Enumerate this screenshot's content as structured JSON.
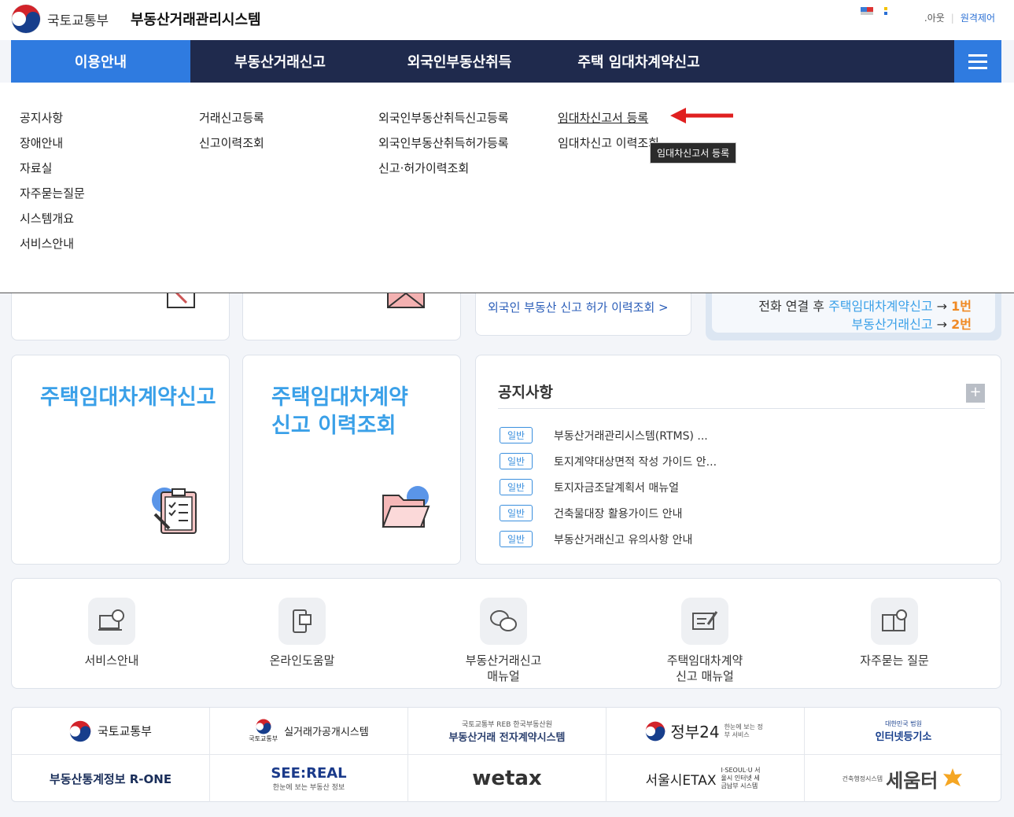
{
  "header": {
    "ministry": "국토교통부",
    "system": "부동산거래관리시스템",
    "links": {
      "about": ".아웃",
      "remote": "원격제어"
    }
  },
  "nav": {
    "items": [
      "이용안내",
      "부동산거래신고",
      "외국인부동산취득",
      "주택 임대차계약신고"
    ]
  },
  "mega_menu": {
    "col1": [
      "공지사항",
      "장애안내",
      "자료실",
      "자주묻는질문",
      "시스템개요",
      "서비스안내"
    ],
    "col2": [
      "거래신고등록",
      "신고이력조회"
    ],
    "col3": [
      "외국인부동산취득신고등록",
      "외국인부동산취득허가등록",
      "신고·허가이력조회"
    ],
    "col4": [
      "임대차신고서 등록",
      "임대차신고 이력조회"
    ],
    "tooltip": "임대차신고서 등록"
  },
  "partial": {
    "foreign_link": "외국인 부동산 신고 허가 이력조회 >",
    "phone_line1_prefix": "전화 연결 후 ",
    "phone_line1_blue": "주택임대차계약신고",
    "phone_line1_arrow": " → ",
    "phone_line1_num": "1번",
    "phone_line2_blue": "부동산거래신고",
    "phone_line2_arrow": " → ",
    "phone_line2_num": "2번"
  },
  "cards": {
    "card1": "주택임대차계약신고",
    "card2_line1": "주택임대차계약",
    "card2_line2": "신고 이력조회"
  },
  "notices": {
    "title": "공지사항",
    "more": "+",
    "items": [
      {
        "badge": "일반",
        "text": "부동산거래관리시스템(RTMS) ..."
      },
      {
        "badge": "일반",
        "text": "토지계약대상면적 작성 가이드 안..."
      },
      {
        "badge": "일반",
        "text": "토지자금조달계획서 매뉴얼"
      },
      {
        "badge": "일반",
        "text": "건축물대장 활용가이드 안내"
      },
      {
        "badge": "일반",
        "text": "부동산거래신고 유의사항 안내"
      }
    ]
  },
  "quick_links": [
    {
      "label": "서비스안내",
      "icon": "monitor-chat-icon"
    },
    {
      "label": "온라인도움말",
      "icon": "phone-doc-icon"
    },
    {
      "label": "부동산거래신고\n매뉴얼",
      "icon": "speech-bubbles-icon"
    },
    {
      "label": "주택임대차계약\n신고 매뉴얼",
      "icon": "pen-doc-icon"
    },
    {
      "label": "자주묻는 질문",
      "icon": "book-info-icon"
    }
  ],
  "banners": {
    "row1": [
      "국토교통부",
      "실거래가공개시스템",
      "부동산거래 전자계약시스템",
      "정부24",
      "인터넷등기소"
    ],
    "row1_sub": [
      "",
      "국토교통부",
      "국토교통부 REB 한국부동산원",
      "한눈에 보는 정부 서비스",
      "대한민국 법원"
    ],
    "row2": [
      "부동산통계정보 R-ONE",
      "SEE:REAL",
      "wetax",
      "서울시ETAX",
      "세움터"
    ],
    "row2_sub": [
      "",
      "한눈에 보는 부동산 정보",
      "",
      "I·SEOUL·U 서울시 인터넷 세금납부 시스템",
      "건축행정시스템"
    ]
  },
  "colors": {
    "nav_bg": "#1f2a4d",
    "accent": "#2f7be0",
    "title_blue": "#3aa0e8",
    "orange": "#f08a24",
    "arrow_red": "#e02020"
  }
}
